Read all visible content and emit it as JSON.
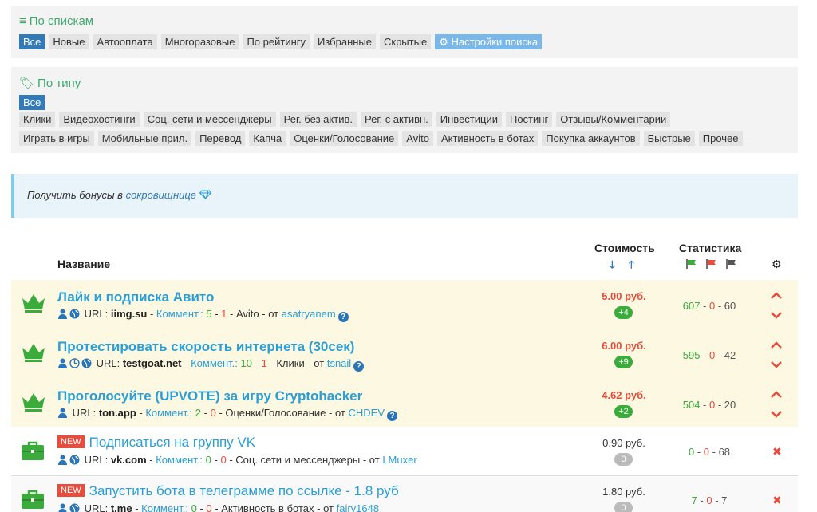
{
  "lists_panel": {
    "title": "По спискам",
    "chips": [
      {
        "label": "Все",
        "state": "active"
      },
      {
        "label": "Новые"
      },
      {
        "label": "Автооплата"
      },
      {
        "label": "Многоразовые"
      },
      {
        "label": "По рейтингу"
      },
      {
        "label": "Избранные"
      },
      {
        "label": "Скрытые"
      },
      {
        "label": "Настройки поиска",
        "state": "light"
      }
    ]
  },
  "type_panel": {
    "title": "По типу",
    "all_label": "Все",
    "row1": [
      "Клики",
      "Видеохостинги",
      "Соц. сети и мессенджеры",
      "Рег. без актив.",
      "Рег. с активн.",
      "Инвестиции",
      "Постинг",
      "Отзывы/Комментарии"
    ],
    "row2": [
      "Играть в игры",
      "Мобильные прил.",
      "Перевод",
      "Капча",
      "Оценки/Голосование",
      "Avito",
      "Активность в ботах",
      "Покупка аккаунтов",
      "Быстрые",
      "Прочее"
    ]
  },
  "bonus": {
    "text": "Получить бонусы в ",
    "link": "сокровищнице"
  },
  "table": {
    "col_name": "Название",
    "col_cost": "Стоимость",
    "col_stats": "Статистика"
  },
  "tasks": [
    {
      "title": "Лайк и подписка Авито",
      "vip": true,
      "icons": [
        "user",
        "globe"
      ],
      "url": "iimg.su",
      "comments_label": "Коммент.:",
      "c_good": "5",
      "c_bad": "1",
      "category": "Avito",
      "from_label": "от",
      "author": "asatryanem",
      "price": "5.00 руб.",
      "bonus": "+4",
      "s_ok": "607",
      "s_bad": "0",
      "s_other": "60"
    },
    {
      "title": "Протестировать скорость интернета (30сек)",
      "vip": true,
      "icons": [
        "user",
        "clock",
        "globe"
      ],
      "url": "testgoat.net",
      "comments_label": "Коммент.:",
      "c_good": "10",
      "c_bad": "1",
      "category": "Клики",
      "from_label": "от",
      "author": "tsnail",
      "price": "6.00 руб.",
      "bonus": "+9",
      "s_ok": "595",
      "s_bad": "0",
      "s_other": "42"
    },
    {
      "title": "Проголосуйте (UPVOTE) за игру Cryptohacker",
      "vip": true,
      "icons": [
        "user"
      ],
      "url": "ton.app",
      "comments_label": "Коммент.:",
      "c_good": "2",
      "c_bad": "0",
      "category": "Оценки/Голосование",
      "from_label": "от",
      "author": "CHDEV",
      "price": "4.62 руб.",
      "bonus": "+2",
      "s_ok": "504",
      "s_bad": "0",
      "s_other": "20"
    },
    {
      "title": "Подписаться на группу VK",
      "vip": false,
      "new": "NEW",
      "icons": [
        "user",
        "globe"
      ],
      "url": "vk.com",
      "comments_label": "Коммент.:",
      "c_good": "0",
      "c_bad": "0",
      "category": "Соц. сети и мессенджеры",
      "from_label": "от",
      "author": "LMuxer",
      "price": "0.90 руб.",
      "bonus": "0",
      "s_ok": "0",
      "s_bad": "0",
      "s_other": "68"
    },
    {
      "title": "Запустить бота в телеграмме по ссылке - 1.8 руб",
      "vip": false,
      "new": "NEW",
      "icons": [
        "user",
        "globe"
      ],
      "url": "t.me",
      "comments_label": "Коммент.:",
      "c_good": "0",
      "c_bad": "0",
      "category": "Активность в ботах",
      "from_label": "от",
      "author": "fairy1648",
      "price": "1.80 руб.",
      "bonus": "0",
      "s_ok": "7",
      "s_bad": "0",
      "s_other": "7"
    }
  ],
  "colors": {
    "green": "#3bab6c",
    "blue": "#337ab7",
    "red": "#e74c3c",
    "link": "#2a9fd6"
  }
}
